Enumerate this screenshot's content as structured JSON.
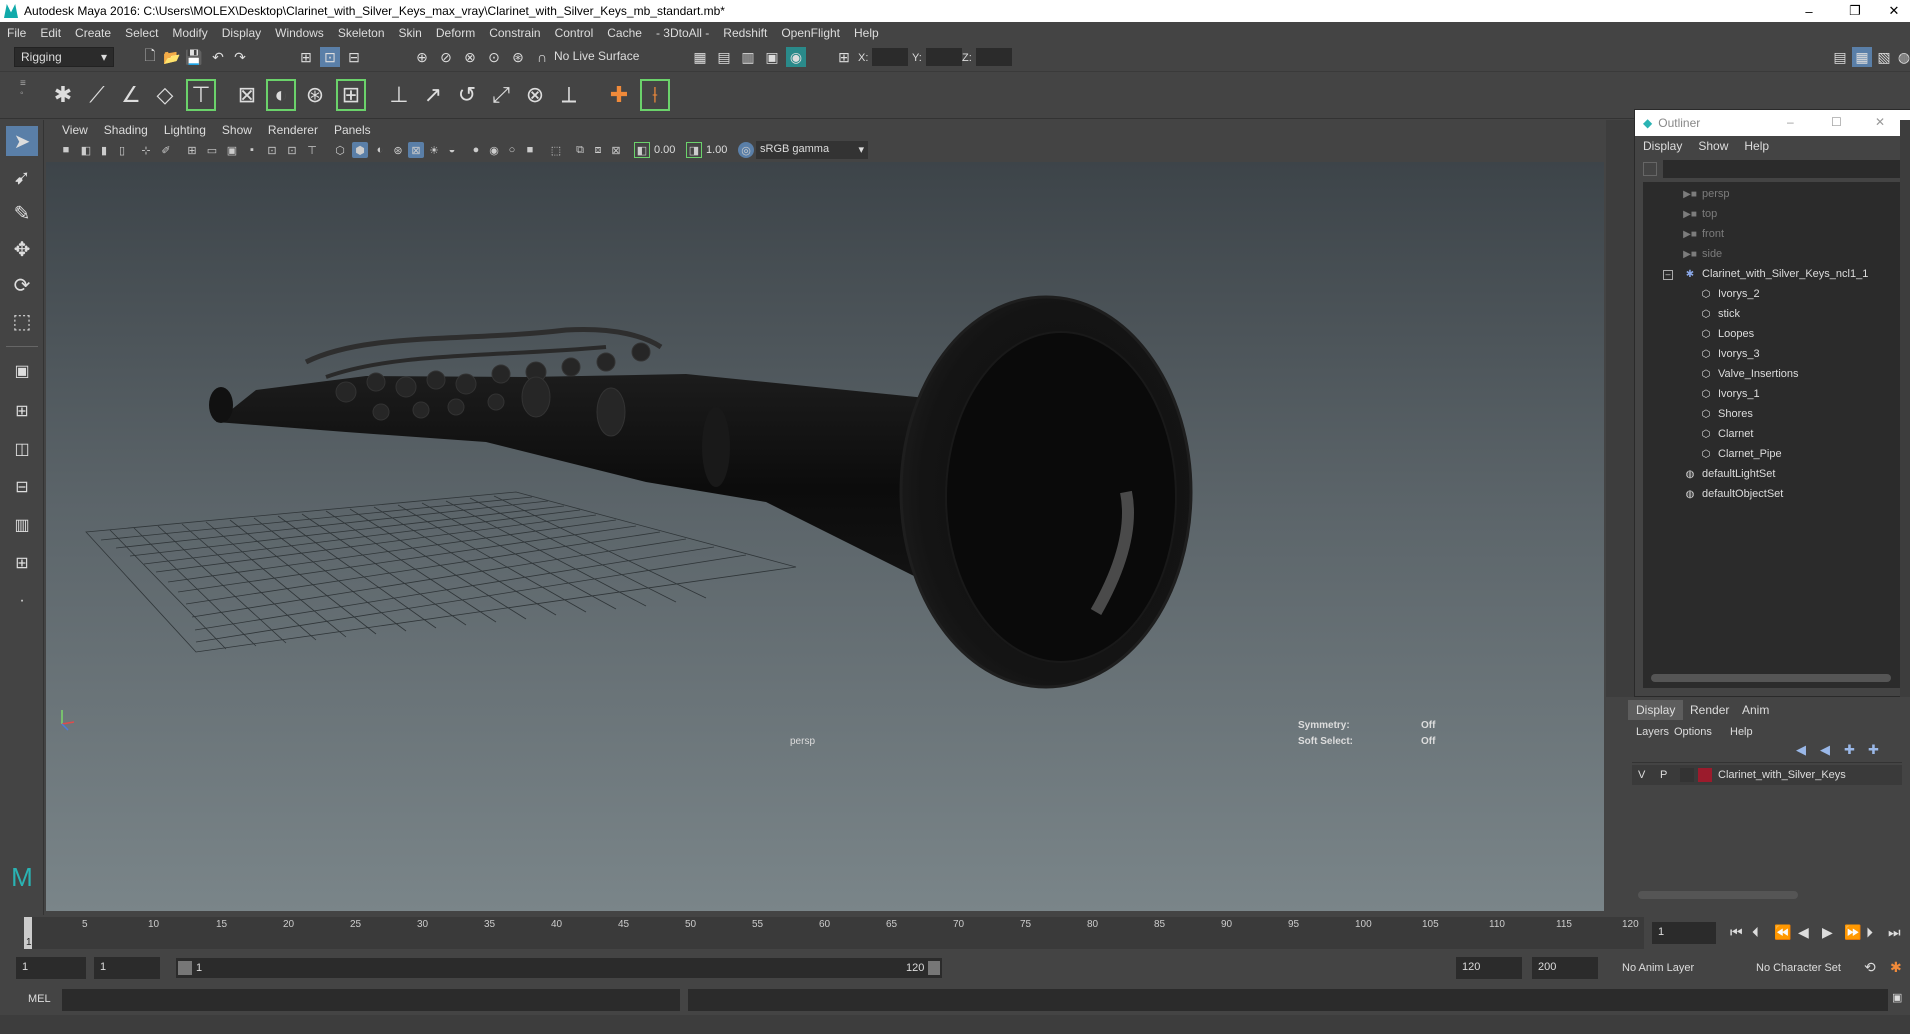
{
  "window": {
    "title": "Autodesk Maya 2016: C:\\Users\\MOLEX\\Desktop\\Clarinet_with_Silver_Keys_max_vray\\Clarinet_with_Silver_Keys_mb_standart.mb*",
    "minimize": "–",
    "restore": "❐",
    "close": "✕"
  },
  "menubar": [
    "File",
    "Edit",
    "Create",
    "Select",
    "Modify",
    "Display",
    "Windows",
    "Skeleton",
    "Skin",
    "Deform",
    "Constrain",
    "Control",
    "Cache",
    "- 3DtoAll -",
    "Redshift",
    "OpenFlight",
    "Help"
  ],
  "toolbar": {
    "mode": "Rigging",
    "live_surface": "No Live Surface",
    "x_label": "X:",
    "y_label": "Y:",
    "z_label": "Z:"
  },
  "viewport": {
    "menu": [
      "View",
      "Shading",
      "Lighting",
      "Show",
      "Renderer",
      "Panels"
    ],
    "exposure": "0.00",
    "gamma": "1.00",
    "colorspace": "sRGB gamma",
    "camera_label": "persp",
    "hud": {
      "symmetry_label": "Symmetry:",
      "symmetry_value": "Off",
      "soft_select_label": "Soft Select:",
      "soft_select_value": "Off"
    }
  },
  "outliner": {
    "title": "Outliner",
    "menu": [
      "Display",
      "Show",
      "Help"
    ],
    "items": [
      {
        "label": "persp",
        "icon": "camera-icon",
        "dim": true
      },
      {
        "label": "top",
        "icon": "camera-icon",
        "dim": true
      },
      {
        "label": "front",
        "icon": "camera-icon",
        "dim": true
      },
      {
        "label": "side",
        "icon": "camera-icon",
        "dim": true
      },
      {
        "label": "Clarinet_with_Silver_Keys_ncl1_1",
        "icon": "group-icon"
      },
      {
        "label": "Ivorys_2",
        "icon": "mesh-icon"
      },
      {
        "label": "stick",
        "icon": "mesh-icon"
      },
      {
        "label": "Loopes",
        "icon": "mesh-icon"
      },
      {
        "label": "Ivorys_3",
        "icon": "mesh-icon"
      },
      {
        "label": "Valve_Insertions",
        "icon": "mesh-icon"
      },
      {
        "label": "Ivorys_1",
        "icon": "mesh-icon"
      },
      {
        "label": "Shores",
        "icon": "mesh-icon"
      },
      {
        "label": "Clarnet",
        "icon": "mesh-icon"
      },
      {
        "label": "Clarnet_Pipe",
        "icon": "mesh-icon"
      },
      {
        "label": "defaultLightSet",
        "icon": "set-icon"
      },
      {
        "label": "defaultObjectSet",
        "icon": "set-icon"
      }
    ]
  },
  "layers": {
    "tabs": [
      "Display",
      "Render",
      "Anim"
    ],
    "menu": [
      "Layers",
      "Options",
      "Help"
    ],
    "row": {
      "v": "V",
      "p": "P",
      "name": "Clarinet_with_Silver_Keys",
      "color": "#9b1b2c"
    }
  },
  "timeline": {
    "ticks": [
      "1",
      "5",
      "10",
      "15",
      "20",
      "25",
      "30",
      "35",
      "40",
      "45",
      "50",
      "55",
      "60",
      "65",
      "70",
      "75",
      "80",
      "85",
      "90",
      "95",
      "100",
      "105",
      "110",
      "115",
      "120"
    ],
    "current_frame": "1"
  },
  "range": {
    "start": "1",
    "start2": "1",
    "slider_start": "1",
    "slider_end": "120",
    "end": "120",
    "end2": "200",
    "anim_layer": "No Anim Layer",
    "character_set": "No Character Set"
  },
  "cmd": {
    "label": "MEL"
  }
}
